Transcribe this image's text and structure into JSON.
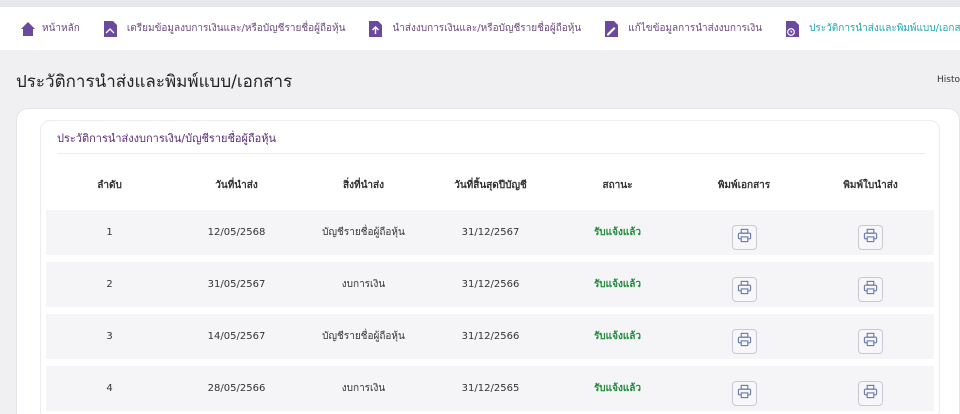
{
  "nav": {
    "items": [
      {
        "label": "หน้าหลัก",
        "icon": "home-icon"
      },
      {
        "label": "เตรียมข้อมูลงบการเงินและ/หรือบัญชีรายชื่อผู้ถือหุ้น",
        "icon": "document-prepare-icon"
      },
      {
        "label": "นำส่งงบการเงินและ/หรือบัญชีรายชื่อผู้ถือหุ้น",
        "icon": "upload-document-icon"
      },
      {
        "label": "แก้ไขข้อมูลการนำส่งงบการเงิน",
        "icon": "edit-document-icon"
      },
      {
        "label": "ประวัติการนำส่งและพิมพ์แบบ/เอกสาร",
        "icon": "history-document-icon"
      }
    ],
    "active_index": 4,
    "colors": {
      "default": "#6b4a7e",
      "active": "#1fa7b0",
      "icon": "#6b4a9e"
    }
  },
  "page": {
    "title": "ประวัติการนำส่งและพิมพ์แบบ/เอกสาร",
    "breadcrumb": "History"
  },
  "card": {
    "title": "ประวัติการนำส่งงบการเงิน/บัญชีรายชื่อผู้ถือหุ้น"
  },
  "table": {
    "headers": [
      "ลำดับ",
      "วันที่นำส่ง",
      "สิ่งที่นำส่ง",
      "วันที่สิ้นสุดปีบัญชี",
      "สถานะ",
      "พิมพ์เอกสาร",
      "พิมพ์ใบนำส่ง"
    ],
    "rows": [
      {
        "no": "1",
        "submit_date": "12/05/2568",
        "item": "บัญชีรายชื่อผู้ถือหุ้น",
        "fiscal_end": "31/12/2567",
        "status": "รับแจ้งแล้ว"
      },
      {
        "no": "2",
        "submit_date": "31/05/2567",
        "item": "งบการเงิน",
        "fiscal_end": "31/12/2566",
        "status": "รับแจ้งแล้ว"
      },
      {
        "no": "3",
        "submit_date": "14/05/2567",
        "item": "บัญชีรายชื่อผู้ถือหุ้น",
        "fiscal_end": "31/12/2566",
        "status": "รับแจ้งแล้ว"
      },
      {
        "no": "4",
        "submit_date": "28/05/2566",
        "item": "งบการเงิน",
        "fiscal_end": "31/12/2565",
        "status": "รับแจ้งแล้ว"
      }
    ],
    "action_icon": "printer-icon",
    "status_color": "#1f8a3a"
  }
}
